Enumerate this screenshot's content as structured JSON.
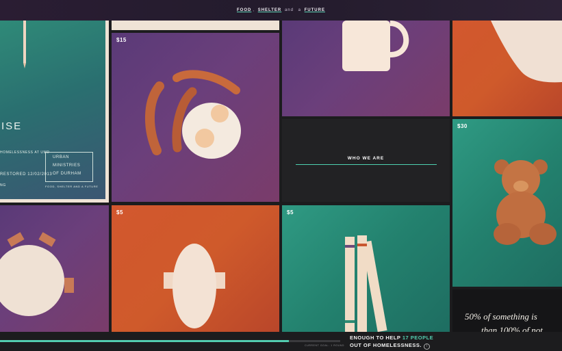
{
  "nav": {
    "food": "FOOD",
    "sep1": ",",
    "shelter": "SHELTER",
    "and": "and",
    "a": "a",
    "future": "FUTURE"
  },
  "tiles": {
    "bacon": {
      "price": "15"
    },
    "crayons": {
      "price": "5"
    },
    "pad": {
      "price": "5"
    },
    "teddy": {
      "price": "30"
    }
  },
  "who": {
    "label": "WHO WE ARE"
  },
  "poster": {
    "headline": "ISE",
    "line1": "HOMELESSNESS AT UMD",
    "line2": "RESTORED 12/02/2013",
    "logo1": "URBAN",
    "logo2": "MINISTRIES",
    "logo3": "OF DURHAM",
    "tagline": "FOOD, SHELTER AND A FUTURE",
    "small": "NG"
  },
  "quote": {
    "line1": "50% of something is",
    "line2": "than 100% of not"
  },
  "footer": {
    "goal_label": "CURRENT GOAL: 1 ROUND",
    "help_pre": "ENOUGH TO HELP",
    "help_count": "17 PEOPLE",
    "help_post": "OUT OF HOMELESSNESS.",
    "info_icon": "i",
    "progress": 0.85
  },
  "colors": {
    "accent": "#53cdb0",
    "purple": "#5a3a78",
    "orange": "#d2572e",
    "teal": "#2f9a83",
    "dark": "#222224"
  }
}
